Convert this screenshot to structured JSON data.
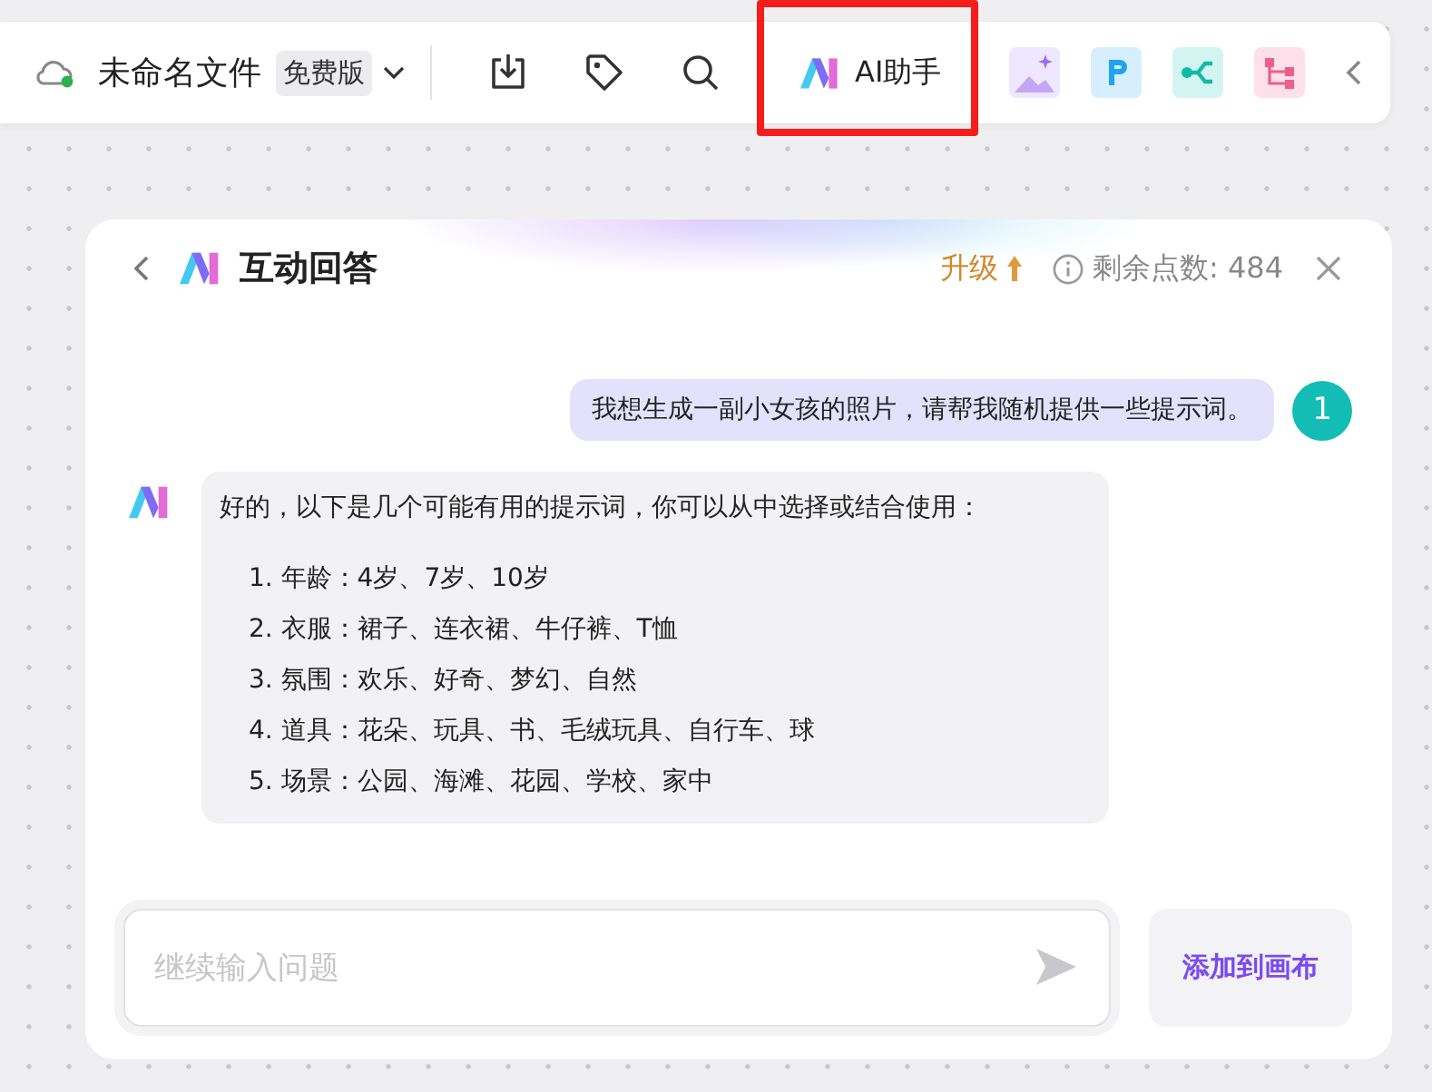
{
  "toolbar": {
    "file_name": "未命名文件",
    "plan_badge": "免费版",
    "ai_button": "AI助手",
    "ai_highlighted": true
  },
  "panel": {
    "title": "互动回答",
    "upgrade": "升级",
    "points": "剩余点数: 484"
  },
  "messages": [
    {
      "kind": "user",
      "text": "我想生成一副小女孩的照片，请帮我随机提供一些提示词。",
      "avatar": "1"
    },
    {
      "kind": "assistant",
      "text": "好的，以下是几个可能有用的提示词，你可以从中选择或结合使用：",
      "items": [
        "1. 年龄：4岁、7岁、10岁",
        "2. 衣服：裙子、连衣裙、牛仔裤、T恤",
        "3. 氛围：欢乐、好奇、梦幻、自然",
        "4. 道具：花朵、玩具、书、毛绒玩具、自行车、球",
        "5. 场景：公园、海滩、花园、学校、家中"
      ]
    }
  ],
  "input": {
    "placeholder": "继续输入问题"
  },
  "add_button": "添加到画布"
}
